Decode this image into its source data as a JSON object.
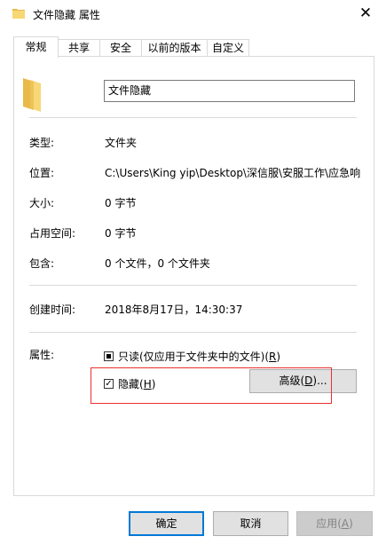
{
  "window": {
    "title": "文件隐藏 属性",
    "close_glyph": "✕"
  },
  "tabs": [
    {
      "label": "常规",
      "active": true
    },
    {
      "label": "共享",
      "active": false
    },
    {
      "label": "安全",
      "active": false
    },
    {
      "label": "以前的版本",
      "active": false
    },
    {
      "label": "自定义",
      "active": false
    }
  ],
  "general": {
    "name": "文件隐藏",
    "type_label": "类型:",
    "type_value": "文件夹",
    "location_label": "位置:",
    "location_value": "C:\\Users\\King yip\\Desktop\\深信服\\安服工作\\应急响",
    "size_label": "大小:",
    "size_value": "0 字节",
    "disk_label": "占用空间:",
    "disk_value": "0 字节",
    "contains_label": "包含:",
    "contains_value": "0 个文件，0 个文件夹",
    "created_label": "创建时间:",
    "created_value": "2018年8月17日，14:30:37",
    "attributes_label": "属性:",
    "readonly_label": "只读(仅应用于文件夹中的文件)(",
    "readonly_key": "R",
    "readonly_close": ")",
    "readonly_state": "indeterminate",
    "hidden_label": "隐藏(",
    "hidden_key": "H",
    "hidden_close": ")",
    "hidden_checked": true,
    "advanced_label": "高级(",
    "advanced_key": "D",
    "advanced_close": ")..."
  },
  "buttons": {
    "ok": "确定",
    "cancel": "取消",
    "apply_prefix": "应用(",
    "apply_key": "A",
    "apply_close": ")"
  },
  "colors": {
    "highlight": "#e8312f",
    "default_border": "#0078d7",
    "folder": "#f8d775"
  }
}
